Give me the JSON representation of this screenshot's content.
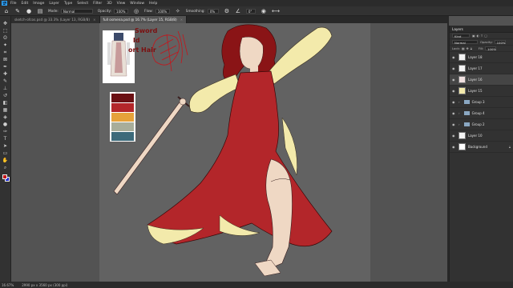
{
  "menu": {
    "logo": "Ps",
    "items": [
      "File",
      "Edit",
      "Image",
      "Layer",
      "Type",
      "Select",
      "Filter",
      "3D",
      "View",
      "Window",
      "Help"
    ]
  },
  "options": {
    "mode_label": "Mode:",
    "mode_value": "Normal",
    "opacity_label": "Opacity:",
    "opacity_value": "100%",
    "flow_label": "Flow:",
    "flow_value": "100%",
    "smoothing_label": "Smoothing:",
    "smoothing_value": "0%",
    "angle_value": "0°"
  },
  "tabs": [
    {
      "label": "sketch-ofcos.psd @ 33.3% (Layer 13, RGB/8)",
      "active": false
    },
    {
      "label": "full osmena.psd @ 16.7% (Layer 15, RGB/8)",
      "active": true
    }
  ],
  "canvas_text": {
    "line1": "Sword",
    "line2": "ld",
    "line3": "ort Hair"
  },
  "palette_colors": [
    "#6b1014",
    "#b3262a",
    "#e6a23a",
    "#a8ad9a",
    "#3c6a7a"
  ],
  "tool_colors": {
    "foreground": "#c4161c",
    "background": "#1a28d0"
  },
  "layers": {
    "title": "Layers",
    "kind_label": "Kind",
    "blend_mode": "Normal",
    "opacity_label": "Opacity:",
    "opacity_value": "100%",
    "lock_label": "Lock:",
    "fill_label": "Fill:",
    "fill_value": "100%",
    "items": [
      {
        "name": "Layer 18",
        "type": "layer",
        "selected": false
      },
      {
        "name": "Layer 17",
        "type": "layer",
        "selected": false
      },
      {
        "name": "Layer 16",
        "type": "layer",
        "selected": true
      },
      {
        "name": "Layer 15",
        "type": "layer",
        "selected": false
      },
      {
        "name": "Group 3",
        "type": "group",
        "selected": false
      },
      {
        "name": "Group 4",
        "type": "group",
        "selected": false
      },
      {
        "name": "Group 2",
        "type": "group",
        "selected": false
      },
      {
        "name": "Layer 10",
        "type": "layer",
        "selected": false
      },
      {
        "name": "Background",
        "type": "layer",
        "selected": false
      }
    ]
  },
  "status": {
    "zoom": "16.67%",
    "doc_size": "2990 px x 3560 px (300 ppi)"
  }
}
